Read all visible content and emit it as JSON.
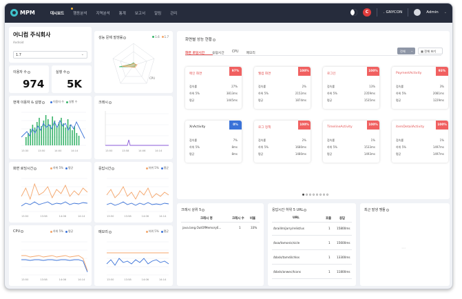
{
  "nav": {
    "logo": "MPM",
    "menu": [
      "대시보드",
      "행동분석",
      "지역분석",
      "통계",
      "보고서",
      "알림",
      "관리"
    ],
    "active_index": 0,
    "brand_letter": "C",
    "project": "GNYCON",
    "user": "Admin"
  },
  "colors": {
    "accent": "#e35050",
    "blue": "#3a72d8",
    "orange": "#f4a56a",
    "navy": "#262c3c",
    "purple": "#8a5ad8",
    "green": "#38b46a",
    "teal": "#3fc1c9"
  },
  "company": {
    "name": "어니컴 주식회사",
    "os": "Android",
    "version": "1.7"
  },
  "metrics": {
    "users_label": "이용자 수",
    "users_value": "974",
    "exec_label": "실행 수",
    "exec_value": "5K"
  },
  "radar": {
    "title": "성능 문제 발생률",
    "legend": [
      "1.6",
      "1.7"
    ],
    "axes": [
      "",
      "",
      "CPU",
      "",
      ""
    ]
  },
  "current_users": {
    "title": "현재 이용자 & 실행",
    "legend": [
      "이용자 수",
      "실행 수"
    ],
    "x": [
      "13:30",
      "13:50",
      "14:00",
      "14:14"
    ]
  },
  "crash": {
    "title": "크래시",
    "x": [
      "13:50",
      "13:58",
      "14:06",
      "14:14"
    ]
  },
  "screen_load": {
    "title": "화면 로딩시간",
    "legend": [
      "하위 5%",
      "평균"
    ],
    "x": [
      "13:50",
      "13:58",
      "14:06",
      "14:14"
    ]
  },
  "response": {
    "title": "응답시간",
    "legend": [
      "하위 5%",
      "평균"
    ],
    "x": [
      "13:50",
      "13:58",
      "14:06",
      "14:14"
    ]
  },
  "cpu": {
    "title": "CPU",
    "legend": [
      "하위 5%",
      "평균"
    ],
    "x": [
      "13:50",
      "13:58",
      "14:06",
      "14:14"
    ]
  },
  "memory": {
    "title": "메모리",
    "legend": [
      "하위 5%",
      "평균"
    ],
    "x": [
      "13:50",
      "13:58",
      "14:06",
      "14:14"
    ]
  },
  "performance": {
    "title": "화면별 성능 현황",
    "tabs": [
      "화면 로딩시간",
      "응답시간",
      "CPU",
      "메모리"
    ],
    "active_tab": 0,
    "select": "전체",
    "view_all": "전체 보기",
    "cards": [
      {
        "name": "메인 화면",
        "badge": "97%",
        "rows": [
          [
            "접속률",
            "27%"
          ],
          [
            "하위 5%",
            "3813ms"
          ],
          [
            "평균",
            "1445ms"
          ]
        ]
      },
      {
        "name": "웰컴 화면",
        "badge": "100%",
        "rows": [
          [
            "접속률",
            "2%"
          ],
          [
            "하위 5%",
            "2152ms"
          ],
          [
            "평균",
            "1874ms"
          ]
        ]
      },
      {
        "name": "로그인",
        "badge": "100%",
        "rows": [
          [
            "접속률",
            "13%"
          ],
          [
            "하위 5%",
            "2359ms"
          ],
          [
            "평균",
            "1535ms"
          ]
        ]
      },
      {
        "name": "PaymentActivity",
        "badge": "93%",
        "rows": [
          [
            "접속률",
            "3%"
          ],
          [
            "하위 5%",
            "2081ms"
          ],
          [
            "평균",
            "1229ms"
          ]
        ]
      },
      {
        "name": "XnActivity",
        "badge": "0%",
        "rows": [
          [
            "접속률",
            "7%"
          ],
          [
            "하위 5%",
            "8ms"
          ],
          [
            "평균",
            "8ms"
          ]
        ],
        "blue": true
      },
      {
        "name": "로그 정책",
        "badge": "100%",
        "rows": [
          [
            "접속률",
            "2%"
          ],
          [
            "하위 5%",
            "1680ms"
          ],
          [
            "평균",
            "1480ms"
          ]
        ]
      },
      {
        "name": "TimelineActivity",
        "badge": "100%",
        "rows": [
          [
            "접속률",
            "1%"
          ],
          [
            "하위 5%",
            "1533ms"
          ],
          [
            "평균",
            "1493ms"
          ]
        ]
      },
      {
        "name": "itemDetailActivity",
        "badge": "100%",
        "rows": [
          [
            "접속률",
            "1%"
          ],
          [
            "하위 5%",
            "1497ms"
          ],
          [
            "평균",
            "1497ms"
          ]
        ]
      }
    ]
  },
  "crash_top": {
    "title": "크래시 상위 5",
    "headers": [
      "크래시 명",
      "크래시 수",
      "비율"
    ],
    "rows": [
      [
        "java.lang.OutOfMemoryE...",
        "1",
        "33%"
      ]
    ]
  },
  "response_url": {
    "title": "응답시간 하위 5 URL",
    "headers": [
      "URL",
      "호출",
      "응답"
    ],
    "rows": [
      [
        "/braillm/jarry/relist/us",
        "1",
        "15800ms"
      ],
      [
        "/boa/tamonis/sicle",
        "1",
        "15600ms"
      ],
      [
        "/bbsls/tamdi/chlos",
        "1",
        "13300ms"
      ],
      [
        "/bbsls/anwec/tcons",
        "1",
        "11800ms"
      ]
    ]
  },
  "recent_events": {
    "title": "최근 발생 맹들"
  }
}
